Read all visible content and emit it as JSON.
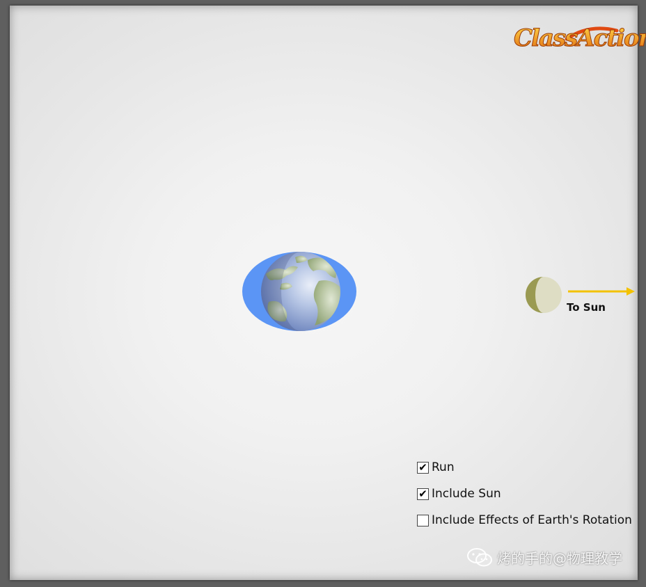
{
  "logo": {
    "text": "ClassAction"
  },
  "scene": {
    "sun_label": "To Sun",
    "colors": {
      "ocean_bulge": "#5b95f5",
      "sun_arrow": "#f3c200",
      "moon_dark": "#9a9a52",
      "moon_light": "#deddc4"
    }
  },
  "controls": [
    {
      "label": "Run",
      "checked": true
    },
    {
      "label": "Include Sun",
      "checked": true
    },
    {
      "label": "Include Effects of Earth's Rotation",
      "checked": false
    }
  ],
  "watermark": {
    "icon": "wechat-icon",
    "text": "烤的手的@物理教学"
  }
}
